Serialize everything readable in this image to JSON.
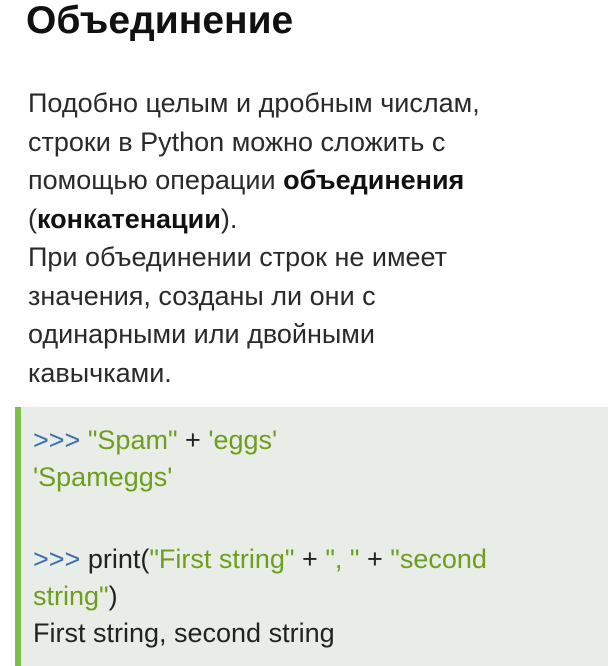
{
  "title": "Объединение",
  "paragraph": {
    "line1": "Подобно целым и дробным числам,",
    "line2": "строки в Python можно сложить с",
    "line3_pre": "помощью операции ",
    "line3_bold": "объединения",
    "line4_open": "(",
    "line4_bold": "конкатенации",
    "line4_close": ").",
    "line5": "При объединении строк не имеет",
    "line6": "значения, созданы ли они с",
    "line7": "одинарными или двойными",
    "line8": "кавычками."
  },
  "code": {
    "prompt": ">>>",
    "ex1_str1": "\"Spam\"",
    "ex1_plus": " + ",
    "ex1_str2": "'eggs'",
    "ex1_output": "'Spameggs'",
    "ex2_func": "print(",
    "ex2_str1": "\"First string\"",
    "ex2_plus1": " + ",
    "ex2_str2": "\", \"",
    "ex2_plus2": " + ",
    "ex2_str3a": "\"second",
    "ex2_str3b": "string\"",
    "ex2_close": ")",
    "ex2_output": "First string, second string"
  },
  "colors": {
    "accent_bar": "#7cc04a",
    "code_background": "#e8ede8",
    "prompt": "#3d6fb0",
    "string": "#6f9e1e"
  }
}
